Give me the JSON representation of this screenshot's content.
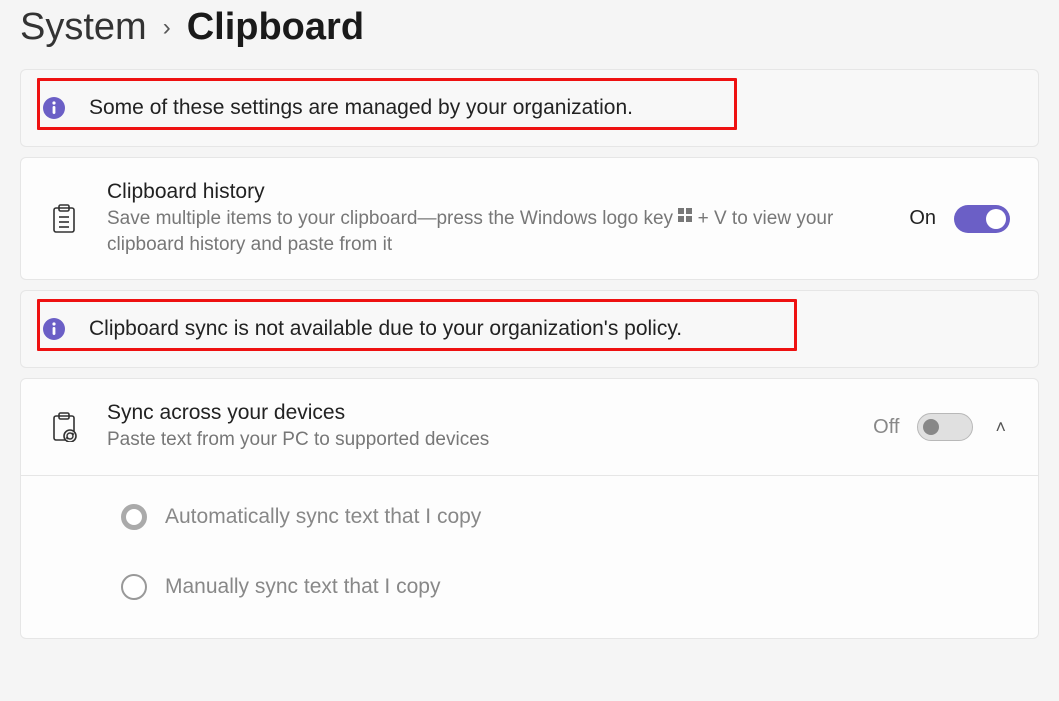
{
  "breadcrumb": {
    "parent": "System",
    "current": "Clipboard"
  },
  "banner_org": {
    "text": "Some of these settings are managed by your organization."
  },
  "history": {
    "title": "Clipboard history",
    "desc_before": "Save multiple items to your clipboard—press the Windows logo key ",
    "desc_after": " + V to view your clipboard history and paste from it",
    "state_label": "On",
    "state_on": true
  },
  "banner_sync": {
    "text": "Clipboard sync is not available due to your organization's policy."
  },
  "sync": {
    "title": "Sync across your devices",
    "desc": "Paste text from your PC to supported devices",
    "state_label": "Off",
    "state_on": false,
    "options": {
      "auto": "Automatically sync text that I copy",
      "manual": "Manually sync text that I copy"
    }
  }
}
